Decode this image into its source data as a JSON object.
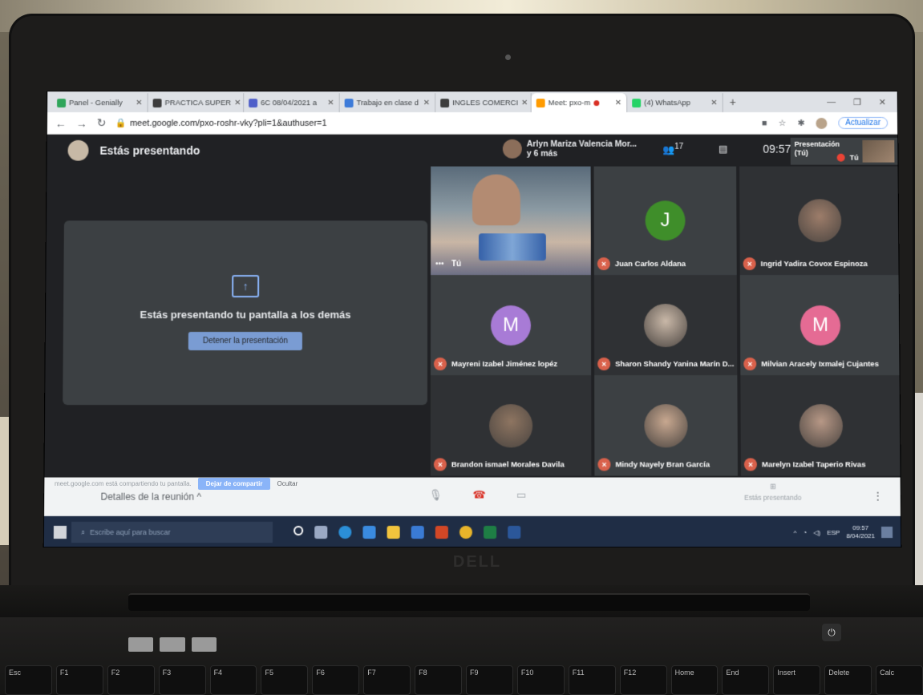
{
  "browser": {
    "tabs": [
      {
        "label": "Panel - Genially",
        "color": "#2fa55a"
      },
      {
        "label": "PRACTICA SUPER",
        "color": "#3d3d3d"
      },
      {
        "label": "6C 08/04/2021 a",
        "color": "#4f5fc9"
      },
      {
        "label": "Trabajo en clase d",
        "color": "#3d7bd9"
      },
      {
        "label": "INGLES COMERCI",
        "color": "#3d3d3d"
      },
      {
        "label": "Meet: pxo-m",
        "color": "#ff9b00",
        "active": true
      },
      {
        "label": "(4) WhatsApp",
        "color": "#25d366"
      }
    ],
    "url": "meet.google.com/pxo-roshr-vky?pli=1&authuser=1",
    "update_label": "Actualizar"
  },
  "meet": {
    "title": "Estás presentando",
    "speaker_line1": "Arlyn Mariza Valencia Mor...",
    "speaker_line2": "y 6 más",
    "participant_count": "17",
    "clock": "09:57",
    "self_tile_label1": "Presentación",
    "self_tile_label2": "(Tú)",
    "self_tile_tu": "Tú",
    "present_message": "Estás presentando tu pantalla a los demás",
    "stop_button": "Detener la presentación",
    "self_video_name": "Tú",
    "participants": [
      {
        "name": "Juan Carlos Aldana",
        "initial": "J",
        "color": "#3f8e2a"
      },
      {
        "name": "Ingrid Yadira Covox Espinoza",
        "photo": "#9d7d6a"
      },
      {
        "name": "Mayreni Izabel Jiménez lopéz",
        "initial": "M",
        "color": "#a87bd6"
      },
      {
        "name": "Sharon Shandy Yanina Marín D...",
        "photo": "#c9b8a8"
      },
      {
        "name": "Milvian Aracely Ixmalej Cujantes",
        "initial": "M",
        "color": "#e56b94"
      },
      {
        "name": "Brandon ismael Morales Davila",
        "photo": "#8e7561"
      },
      {
        "name": "Mindy Nayely Bran García",
        "photo": "#c8a890"
      },
      {
        "name": "Marelyn Izabel Taperio Rivas",
        "photo": "#b79886"
      }
    ],
    "share_notice": "meet.google.com está compartiendo tu pantalla.",
    "share_stop": "Dejar de compartir",
    "share_hide": "Ocultar",
    "details": "Detalles de la reunión",
    "presenting_label": "Estás presentando"
  },
  "taskbar": {
    "search_placeholder": "Escribe aquí para buscar",
    "lang": "ESP",
    "time": "09:57",
    "date": "8/04/2021"
  },
  "keyboard": [
    "Esc",
    "F1",
    "F2",
    "F3",
    "F4",
    "F5",
    "F6",
    "F7",
    "F8",
    "F9",
    "F10",
    "F11",
    "F12",
    "Home",
    "End",
    "Insert",
    "Delete",
    "Calc"
  ],
  "brand": "DELL"
}
